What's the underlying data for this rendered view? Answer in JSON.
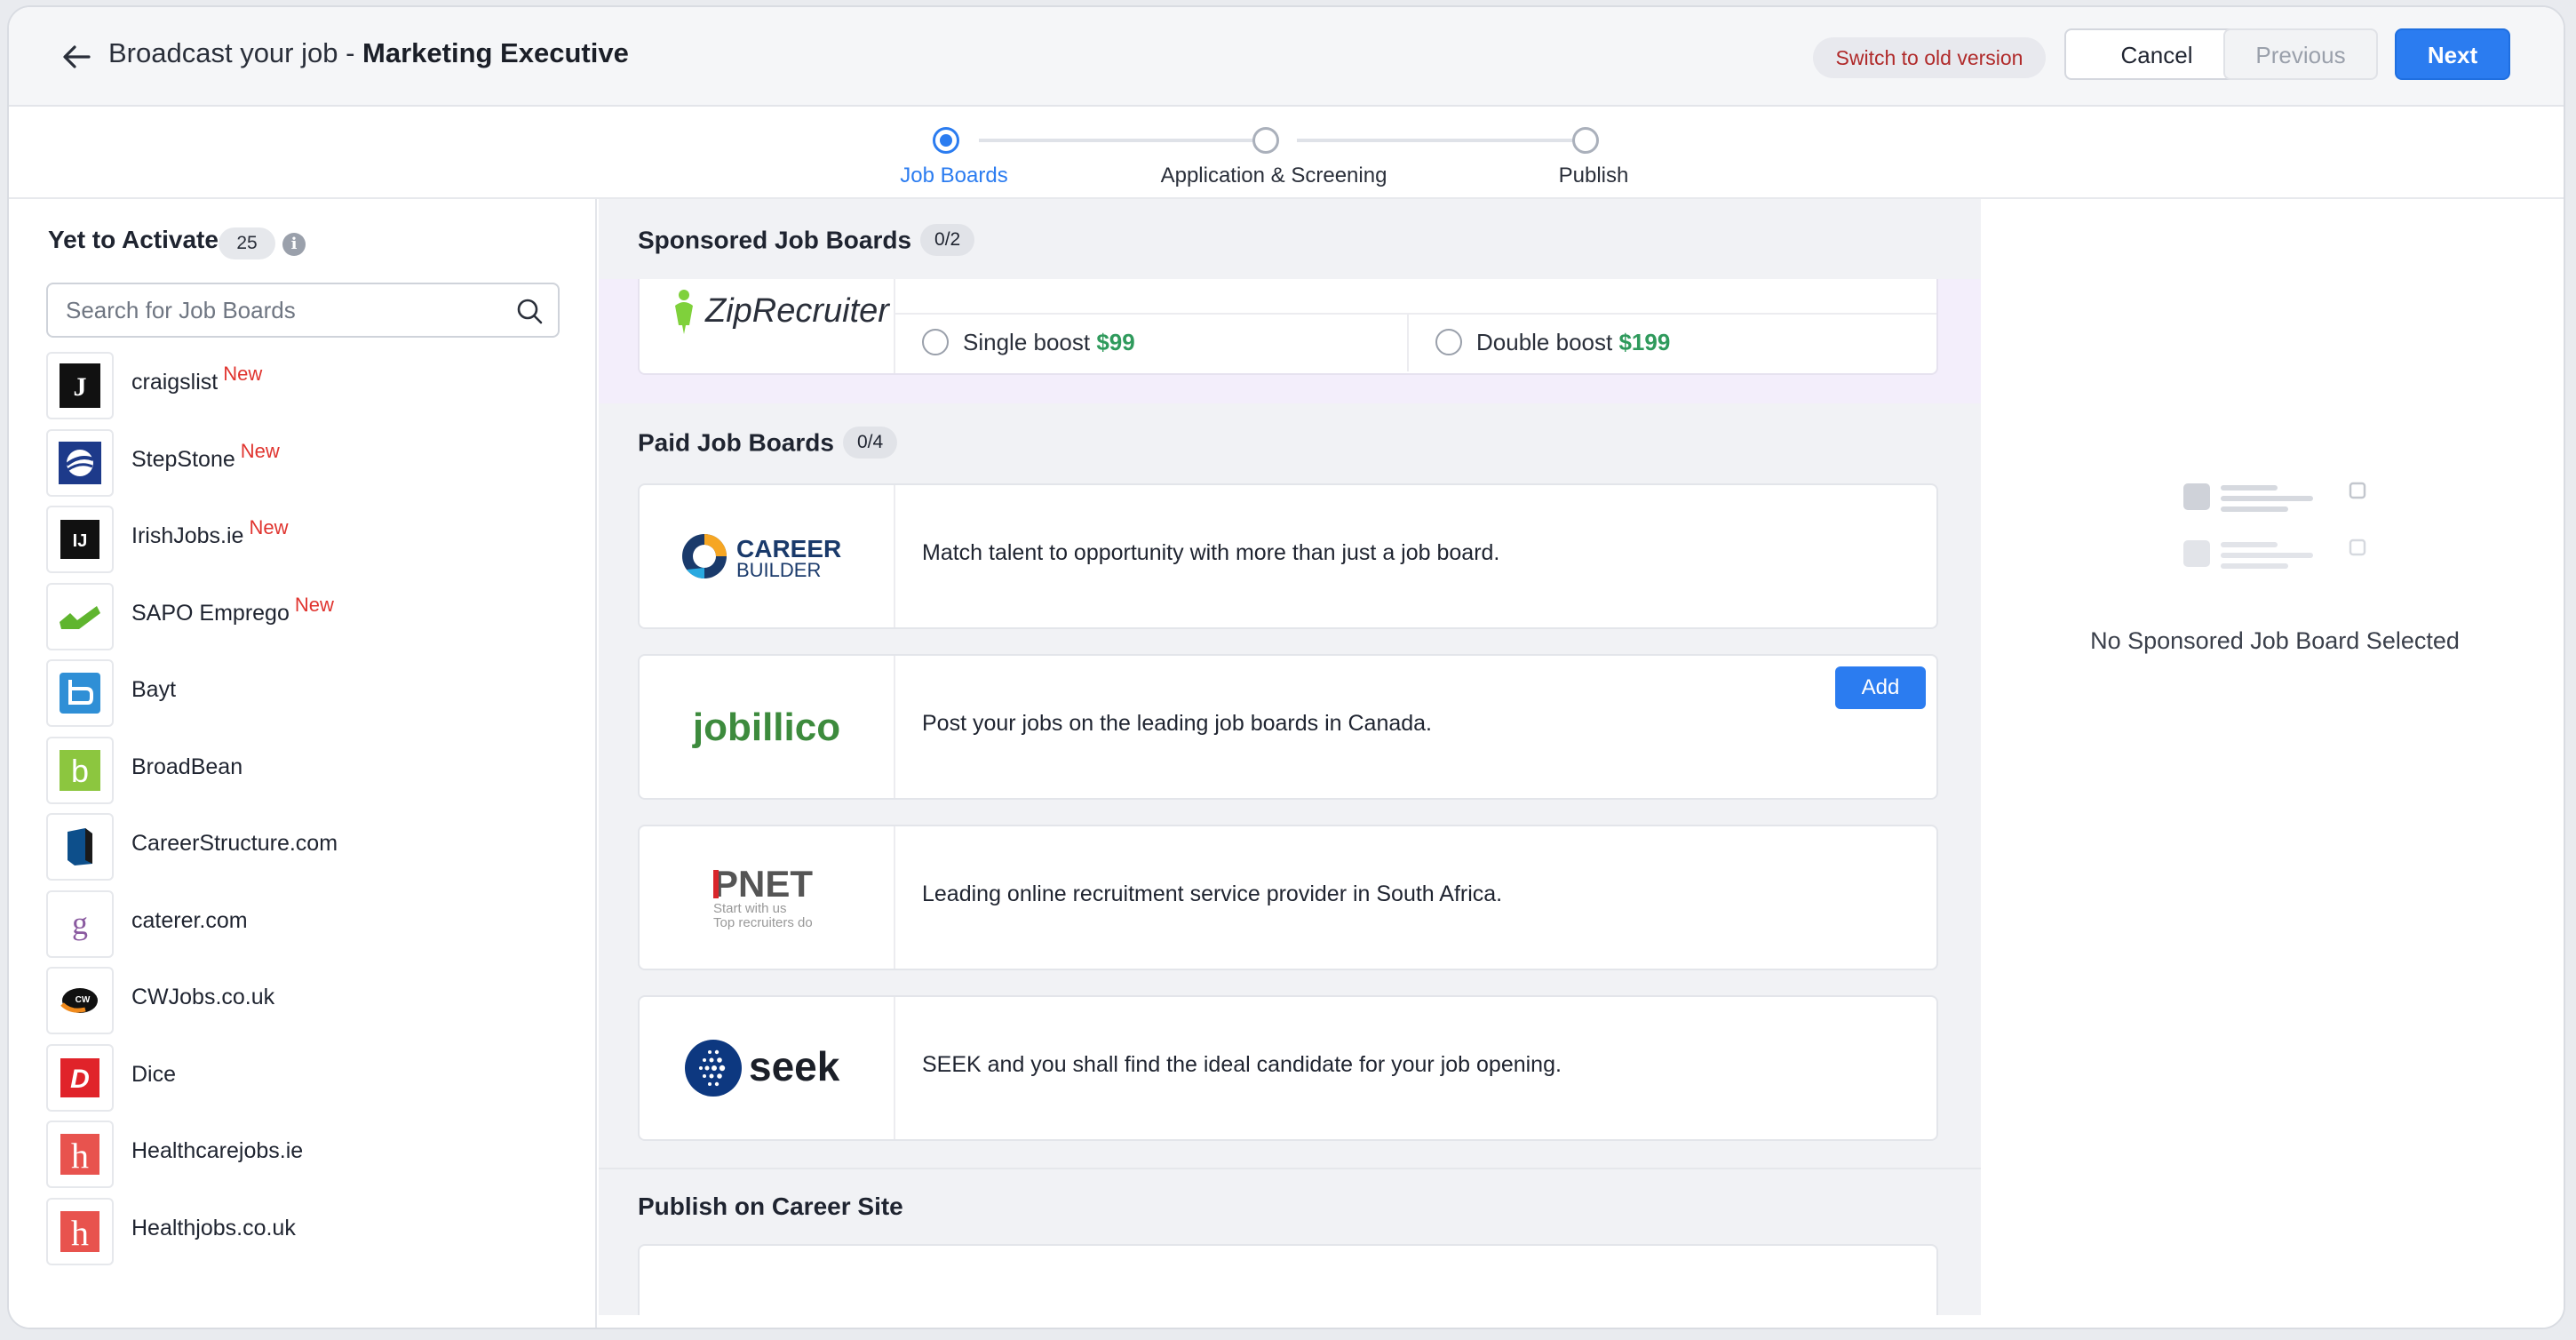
{
  "header": {
    "title_prefix": "Broadcast your job - ",
    "title_job": "Marketing Executive",
    "switch_label": "Switch to old version",
    "cancel_label": "Cancel",
    "previous_label": "Previous",
    "next_label": "Next"
  },
  "stepper": {
    "steps": [
      {
        "label": "Job Boards",
        "active": true
      },
      {
        "label": "Application & Screening",
        "active": false
      },
      {
        "label": "Publish",
        "active": false
      }
    ]
  },
  "left": {
    "title": "Yet to Activate",
    "count": "25",
    "search_placeholder": "Search for Job Boards",
    "new_label": "New",
    "boards": [
      {
        "name": "craigslist",
        "is_new": true
      },
      {
        "name": "StepStone",
        "is_new": true
      },
      {
        "name": "IrishJobs.ie",
        "is_new": true
      },
      {
        "name": "SAPO Emprego",
        "is_new": true
      },
      {
        "name": "Bayt",
        "is_new": false
      },
      {
        "name": "BroadBean",
        "is_new": false
      },
      {
        "name": "CareerStructure.com",
        "is_new": false
      },
      {
        "name": "caterer.com",
        "is_new": false
      },
      {
        "name": "CWJobs.co.uk",
        "is_new": false
      },
      {
        "name": "Dice",
        "is_new": false
      },
      {
        "name": "Healthcarejobs.ie",
        "is_new": false
      },
      {
        "name": "Healthjobs.co.uk",
        "is_new": false
      }
    ]
  },
  "center": {
    "sponsored": {
      "title": "Sponsored Job Boards",
      "count": "0/2",
      "zip_logo": "ZipRecruiter",
      "single_label": "Single boost ",
      "single_price": "$99",
      "double_label": "Double boost ",
      "double_price": "$199"
    },
    "paid": {
      "title": "Paid Job Boards",
      "count": "0/4",
      "add_label": "Add",
      "cards": [
        {
          "logo_line1": "CAREER",
          "logo_line2": "BUILDER",
          "desc": "Match talent to opportunity with more than just a job board."
        },
        {
          "logo_text": "jobillico",
          "desc": "Post your jobs on the leading job boards in Canada."
        },
        {
          "logo_text": "PNET",
          "logo_sub1": "Start with us",
          "logo_sub2": "Top recruiters do",
          "desc": "Leading online recruitment service provider in South Africa."
        },
        {
          "logo_text": "seek",
          "desc": "SEEK and you shall find the ideal candidate for your job opening."
        }
      ]
    },
    "career_site": {
      "title": "Publish on Career Site"
    }
  },
  "right": {
    "empty_text": "No Sponsored Job Board Selected"
  },
  "colors": {
    "accent": "#2b7cf0",
    "new_tag": "#e0342f",
    "price": "#2f9a5c"
  }
}
